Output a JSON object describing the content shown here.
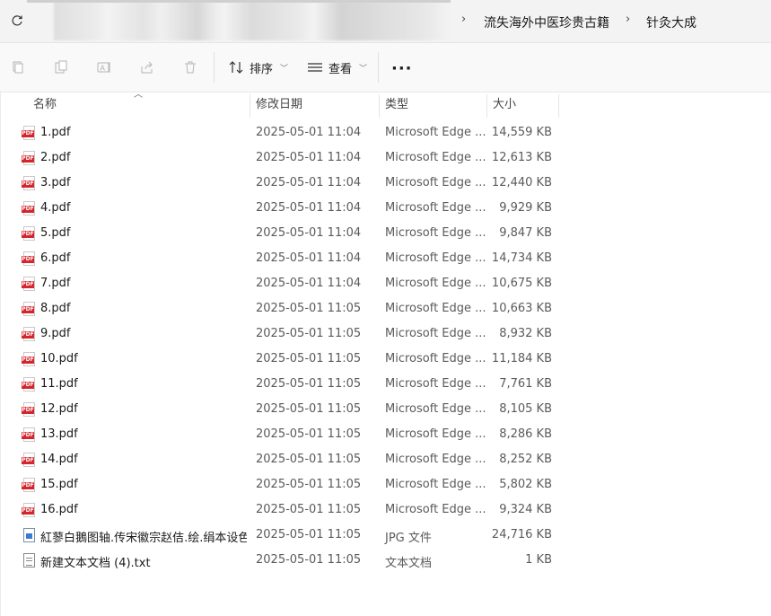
{
  "address_bar": {
    "breadcrumbs": [
      "流失海外中医珍贵古籍",
      "针灸大成"
    ]
  },
  "toolbar": {
    "sort_label": "排序",
    "view_label": "查看",
    "more_label": "···"
  },
  "columns": {
    "name": "名称",
    "date": "修改日期",
    "type": "类型",
    "size": "大小"
  },
  "files": [
    {
      "name": "1.pdf",
      "date": "2025-05-01 11:04",
      "type": "Microsoft Edge ...",
      "size": "14,559 KB",
      "icon": "pdf-icon"
    },
    {
      "name": "2.pdf",
      "date": "2025-05-01 11:04",
      "type": "Microsoft Edge ...",
      "size": "12,613 KB",
      "icon": "pdf-icon"
    },
    {
      "name": "3.pdf",
      "date": "2025-05-01 11:04",
      "type": "Microsoft Edge ...",
      "size": "12,440 KB",
      "icon": "pdf-icon"
    },
    {
      "name": "4.pdf",
      "date": "2025-05-01 11:04",
      "type": "Microsoft Edge ...",
      "size": "9,929 KB",
      "icon": "pdf-icon"
    },
    {
      "name": "5.pdf",
      "date": "2025-05-01 11:04",
      "type": "Microsoft Edge ...",
      "size": "9,847 KB",
      "icon": "pdf-icon"
    },
    {
      "name": "6.pdf",
      "date": "2025-05-01 11:04",
      "type": "Microsoft Edge ...",
      "size": "14,734 KB",
      "icon": "pdf-icon"
    },
    {
      "name": "7.pdf",
      "date": "2025-05-01 11:04",
      "type": "Microsoft Edge ...",
      "size": "10,675 KB",
      "icon": "pdf-icon"
    },
    {
      "name": "8.pdf",
      "date": "2025-05-01 11:05",
      "type": "Microsoft Edge ...",
      "size": "10,663 KB",
      "icon": "pdf-icon"
    },
    {
      "name": "9.pdf",
      "date": "2025-05-01 11:05",
      "type": "Microsoft Edge ...",
      "size": "8,932 KB",
      "icon": "pdf-icon"
    },
    {
      "name": "10.pdf",
      "date": "2025-05-01 11:05",
      "type": "Microsoft Edge ...",
      "size": "11,184 KB",
      "icon": "pdf-icon"
    },
    {
      "name": "11.pdf",
      "date": "2025-05-01 11:05",
      "type": "Microsoft Edge ...",
      "size": "7,761 KB",
      "icon": "pdf-icon"
    },
    {
      "name": "12.pdf",
      "date": "2025-05-01 11:05",
      "type": "Microsoft Edge ...",
      "size": "8,105 KB",
      "icon": "pdf-icon"
    },
    {
      "name": "13.pdf",
      "date": "2025-05-01 11:05",
      "type": "Microsoft Edge ...",
      "size": "8,286 KB",
      "icon": "pdf-icon"
    },
    {
      "name": "14.pdf",
      "date": "2025-05-01 11:05",
      "type": "Microsoft Edge ...",
      "size": "8,252 KB",
      "icon": "pdf-icon"
    },
    {
      "name": "15.pdf",
      "date": "2025-05-01 11:05",
      "type": "Microsoft Edge ...",
      "size": "5,802 KB",
      "icon": "pdf-icon"
    },
    {
      "name": "16.pdf",
      "date": "2025-05-01 11:05",
      "type": "Microsoft Edge ...",
      "size": "9,324 KB",
      "icon": "pdf-icon"
    },
    {
      "name": "紅蓼白鵝图轴.传宋徽宗赵佶.绘.绢本设色....",
      "date": "2025-05-01 11:05",
      "type": "JPG 文件",
      "size": "24,716 KB",
      "icon": "image-icon"
    },
    {
      "name": "新建文本文档 (4).txt",
      "date": "2025-05-01 11:05",
      "type": "文本文档",
      "size": "1 KB",
      "icon": "text-file-icon"
    }
  ]
}
